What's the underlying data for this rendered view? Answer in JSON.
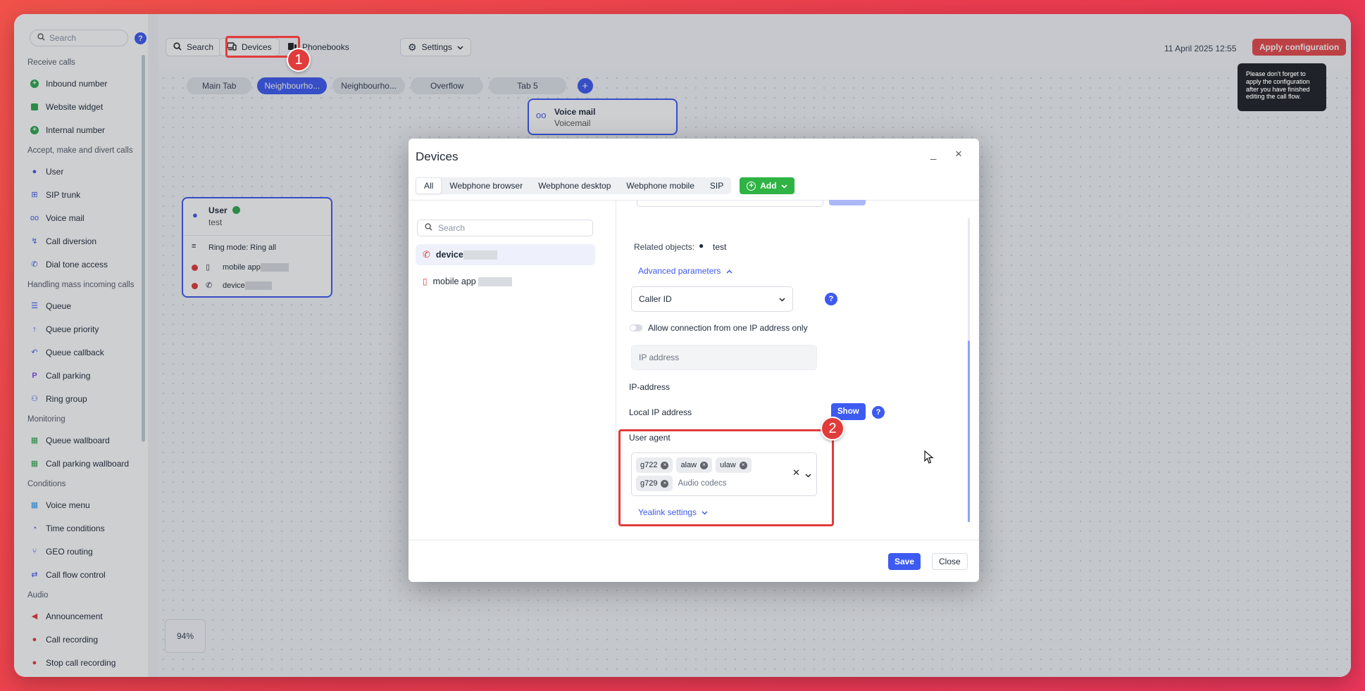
{
  "sidebar": {
    "search_placeholder": "Search",
    "help": "?",
    "sections": [
      {
        "title": "Receive calls",
        "items": [
          {
            "label": "Inbound number",
            "icon": "plus-circle-icon"
          },
          {
            "label": "Website widget",
            "icon": "widget-icon"
          },
          {
            "label": "Internal number",
            "icon": "plus-circle-icon"
          }
        ]
      },
      {
        "title": "Accept, make and divert calls",
        "items": [
          {
            "label": "User",
            "icon": "user-icon"
          },
          {
            "label": "SIP trunk",
            "icon": "sip-trunk-icon"
          },
          {
            "label": "Voice mail",
            "icon": "voicemail-icon"
          },
          {
            "label": "Call diversion",
            "icon": "diversion-icon"
          },
          {
            "label": "Dial tone access",
            "icon": "dial-tone-icon"
          }
        ]
      },
      {
        "title": "Handling mass incoming calls",
        "items": [
          {
            "label": "Queue",
            "icon": "queue-icon"
          },
          {
            "label": "Queue priority",
            "icon": "arrow-up-icon"
          },
          {
            "label": "Queue callback",
            "icon": "callback-icon"
          },
          {
            "label": "Call parking",
            "icon": "parking-icon"
          },
          {
            "label": "Ring group",
            "icon": "group-icon"
          }
        ]
      },
      {
        "title": "Monitoring",
        "items": [
          {
            "label": "Queue wallboard",
            "icon": "wallboard-icon"
          },
          {
            "label": "Call parking wallboard",
            "icon": "wallboard-icon"
          }
        ]
      },
      {
        "title": "Conditions",
        "items": [
          {
            "label": "Voice menu",
            "icon": "menu-icon"
          },
          {
            "label": "Time conditions",
            "icon": "clock-icon"
          },
          {
            "label": "GEO routing",
            "icon": "geo-icon"
          },
          {
            "label": "Call flow control",
            "icon": "flow-icon"
          }
        ]
      },
      {
        "title": "Audio",
        "items": [
          {
            "label": "Announcement",
            "icon": "megaphone-icon"
          },
          {
            "label": "Call recording",
            "icon": "mic-icon"
          },
          {
            "label": "Stop call recording",
            "icon": "mic-off-icon"
          }
        ]
      }
    ]
  },
  "toolbar": {
    "search_label": "Search",
    "devices_label": "Devices",
    "phonebooks_label": "Phonebooks",
    "settings_label": "Settings",
    "date": "11 April 2025 12:55",
    "apply_label": "Apply configuration",
    "tooltip": "Please don't forget to apply the configuration after you have finished editing the call flow."
  },
  "canvas_tabs": [
    "Main Tab",
    "Neighbourho...",
    "Neighbourho...",
    "Overflow",
    "Tab 5"
  ],
  "canvas_tab_active": 1,
  "voicemail_node": {
    "title": "Voice mail",
    "subtitle": "Voicemail"
  },
  "user_node": {
    "title": "User",
    "subtitle": "test",
    "ring_mode": "Ring mode: Ring all",
    "device1": "mobile app",
    "device2": "device"
  },
  "zoom": "94%",
  "annotations": {
    "one": "1",
    "two": "2"
  },
  "modal": {
    "title": "Devices",
    "minimize": "_",
    "close": "×",
    "tabs": [
      "All",
      "Webphone browser",
      "Webphone desktop",
      "Webphone mobile",
      "SIP"
    ],
    "active_tab": "All",
    "add_label": "Add",
    "search_placeholder": "Search",
    "devices": [
      {
        "label": "device"
      },
      {
        "label": "mobile app"
      }
    ],
    "related_label": "Related objects:",
    "related_value": "test",
    "advanced_label": "Advanced parameters",
    "caller_id": "Caller ID",
    "allow_ip_label": "Allow connection from one IP address only",
    "ip_placeholder": "IP address",
    "ip_address_label": "IP-address",
    "local_ip_label": "Local IP address",
    "show_label": "Show",
    "user_agent_label": "User agent",
    "codecs": [
      "g722",
      "alaw",
      "ulaw",
      "g729"
    ],
    "codecs_placeholder": "Audio codecs",
    "yealink_label": "Yealink settings",
    "save_label": "Save",
    "close_label": "Close"
  },
  "colors": {
    "accent": "#3d5af1",
    "danger": "#e8494b",
    "success": "#2fb344",
    "annotation": "#e23b3b"
  }
}
